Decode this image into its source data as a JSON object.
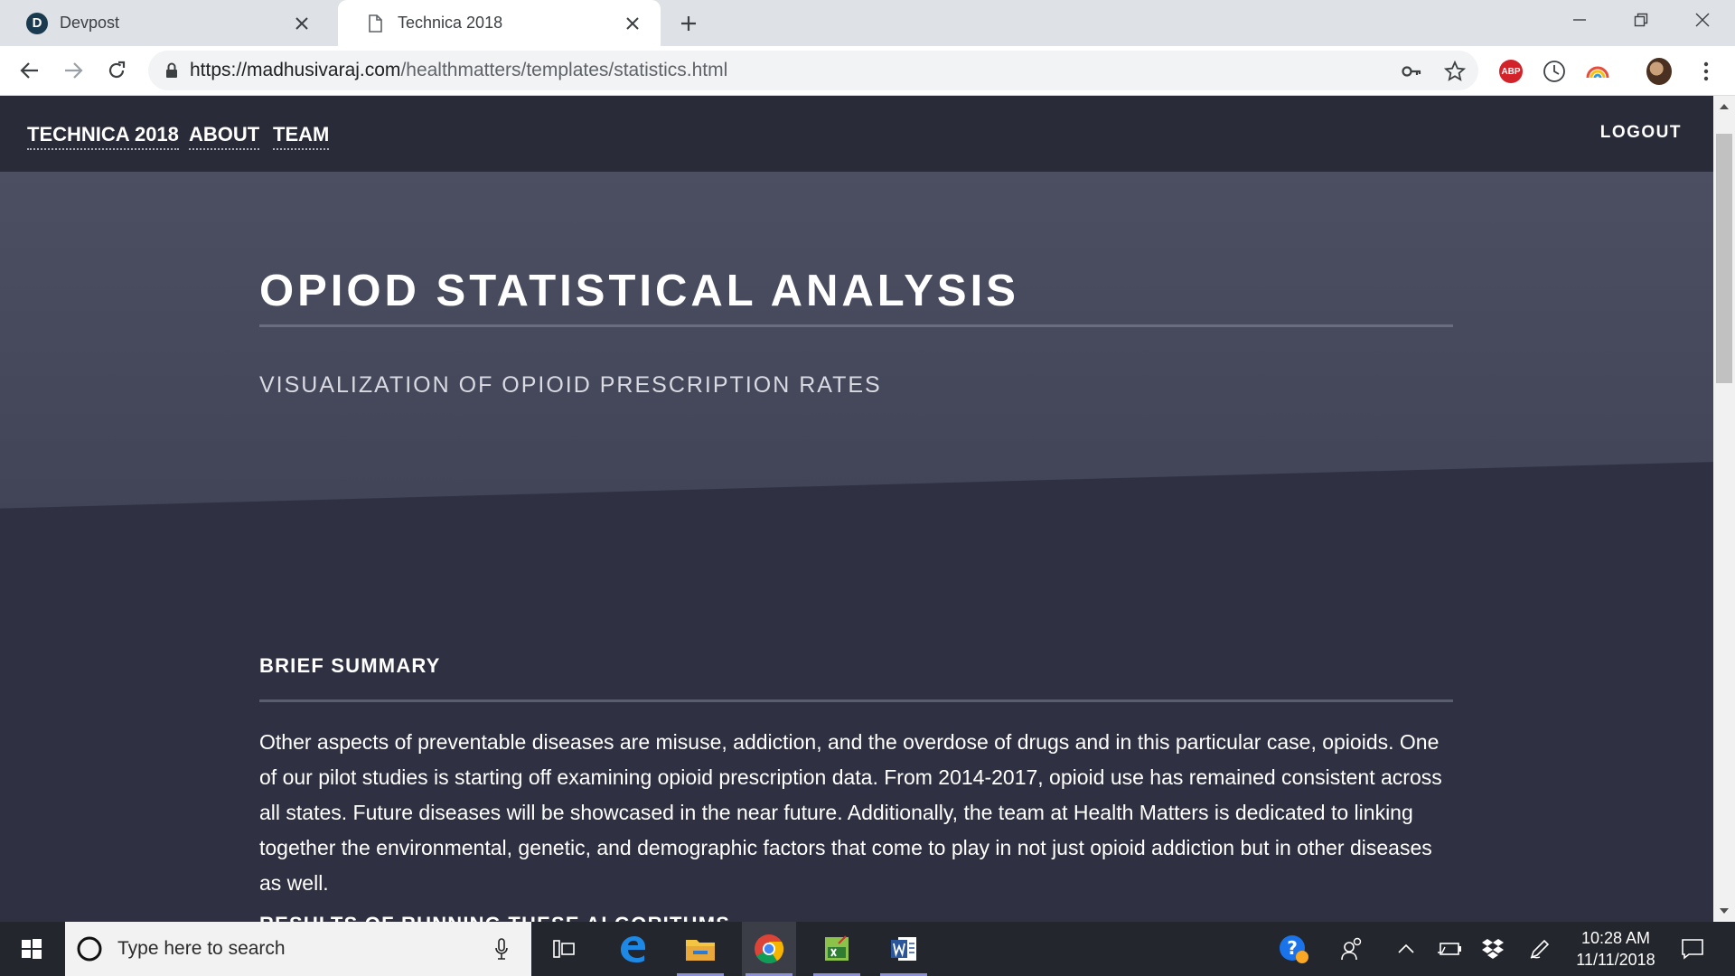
{
  "browser": {
    "tabs": [
      {
        "title": "Devpost",
        "favicon": "devpost-logo",
        "favicon_letter": "D",
        "active": false
      },
      {
        "title": "Technica 2018",
        "favicon": "document-icon",
        "active": true
      }
    ],
    "url_host": "https://madhusivaraj.com",
    "url_path": "/healthmatters/templates/statistics.html",
    "extensions": [
      "key-icon",
      "star-icon",
      "adblock-plus-icon",
      "clock-icon",
      "rainbow-icon",
      "avatar",
      "menu-icon"
    ],
    "abp_label": "ABP"
  },
  "site_nav": {
    "links": [
      "TECHNICA 2018",
      "ABOUT",
      "TEAM"
    ],
    "logout": "LOGOUT"
  },
  "hero": {
    "title": "OPIOD STATISTICAL ANALYSIS",
    "subtitle": "VISUALIZATION OF OPIOID PRESCRIPTION RATES"
  },
  "summary": {
    "heading": "BRIEF SUMMARY",
    "body": "Other aspects of preventable diseases are misuse, addiction, and the overdose of drugs and in this particular case, opioids. One of our pilot studies is starting off examining opioid prescription data. From 2014-2017, opioid use has remained consistent across all states. Future diseases will be showcased in the near future. Additionally, the team at Health Matters is dedicated to linking together the environmental, genetic, and demographic factors that come to play in not just opioid addiction but in other diseases as well."
  },
  "results_heading": "RESULTS OF RUNNING THESE ALGORITHMS",
  "taskbar": {
    "search_placeholder": "Type here to search",
    "apps": [
      "task-view-icon",
      "edge-icon",
      "file-explorer-icon",
      "chrome-icon",
      "excel-icon",
      "word-icon"
    ],
    "tray": [
      "help-icon",
      "people-icon",
      "chevron-up-icon",
      "battery-icon",
      "dropbox-icon",
      "pen-icon",
      "notification-icon"
    ],
    "time": "10:28 AM",
    "date": "11/11/2018"
  },
  "colors": {
    "nav_bg": "#2a2b38",
    "hero_bg": "#464a5c",
    "body_bg": "#2f3142",
    "taskbar_bg": "#24262d",
    "tabstrip_bg": "#dee1e6"
  }
}
